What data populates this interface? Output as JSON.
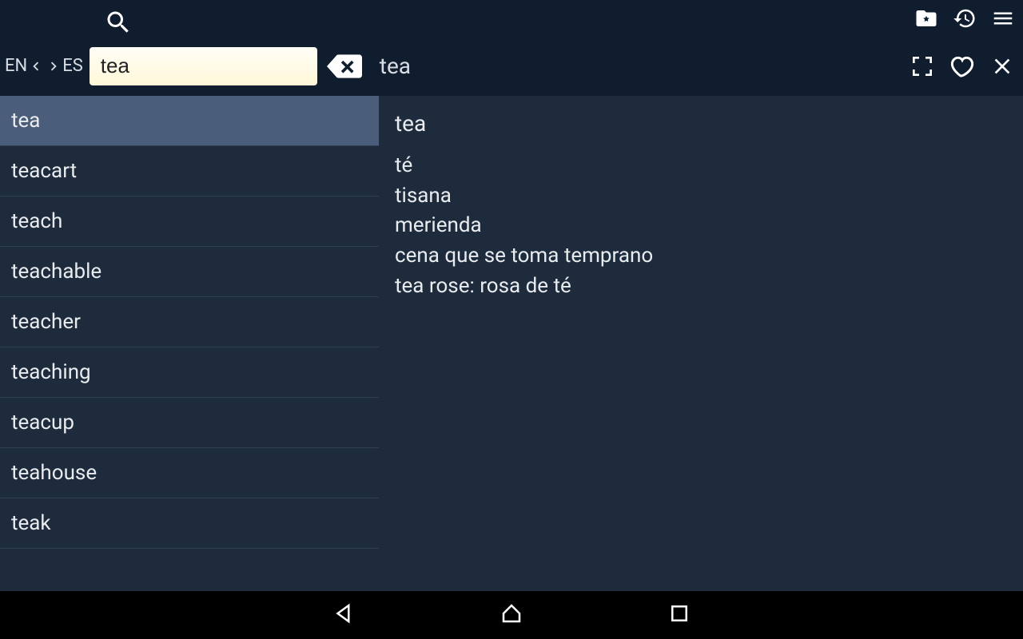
{
  "langFrom": "EN",
  "langTo": "ES",
  "searchValue": "tea",
  "headerWord": "tea",
  "suggestions": [
    "tea",
    "teacart",
    "teach",
    "teachable",
    "teacher",
    "teaching",
    "teacup",
    "teahouse",
    "teak"
  ],
  "selectedIndex": 0,
  "detail": {
    "title": "tea",
    "lines": [
      "té",
      "tisana",
      "merienda",
      "cena que se toma temprano",
      "tea rose: rosa de té"
    ]
  }
}
